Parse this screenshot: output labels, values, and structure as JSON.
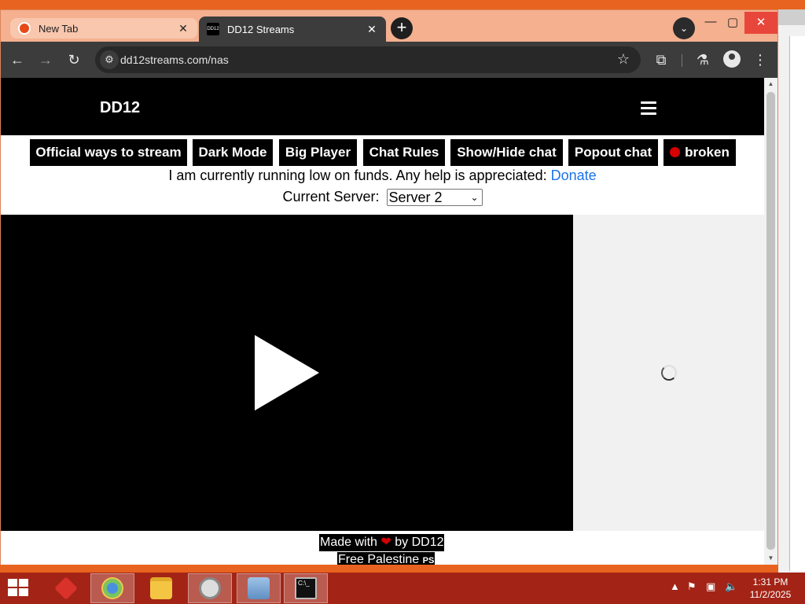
{
  "browser": {
    "tabs": [
      {
        "title": "New Tab",
        "active": false
      },
      {
        "title": "DD12 Streams",
        "active": true,
        "favicon_text": "DD12"
      }
    ],
    "new_tab_label": "+",
    "url": "dd12streams.com/nas"
  },
  "site": {
    "logo": "DD12",
    "buttons": [
      "Official ways to stream",
      "Dark Mode",
      "Big Player",
      "Chat Rules",
      "Show/Hide chat",
      "Popout chat",
      "broken"
    ],
    "status_dot_color": "#d50000",
    "funds_text": "I am currently running low on funds. Any help is appreciated: ",
    "donate_link": "Donate",
    "server_label": "Current Server: ",
    "server_selected": "Server 2",
    "footer_made_with": "Made with",
    "footer_by": "by DD12",
    "footer_free": "Free Palestine",
    "footer_flag": "PS"
  },
  "taskbar": {
    "time": "1:31 PM",
    "date": "11/2/2025"
  },
  "colors": {
    "accent_link": "#1a73e8",
    "taskbar_bg": "#a32416",
    "desktop_bg": "#e8631f"
  }
}
